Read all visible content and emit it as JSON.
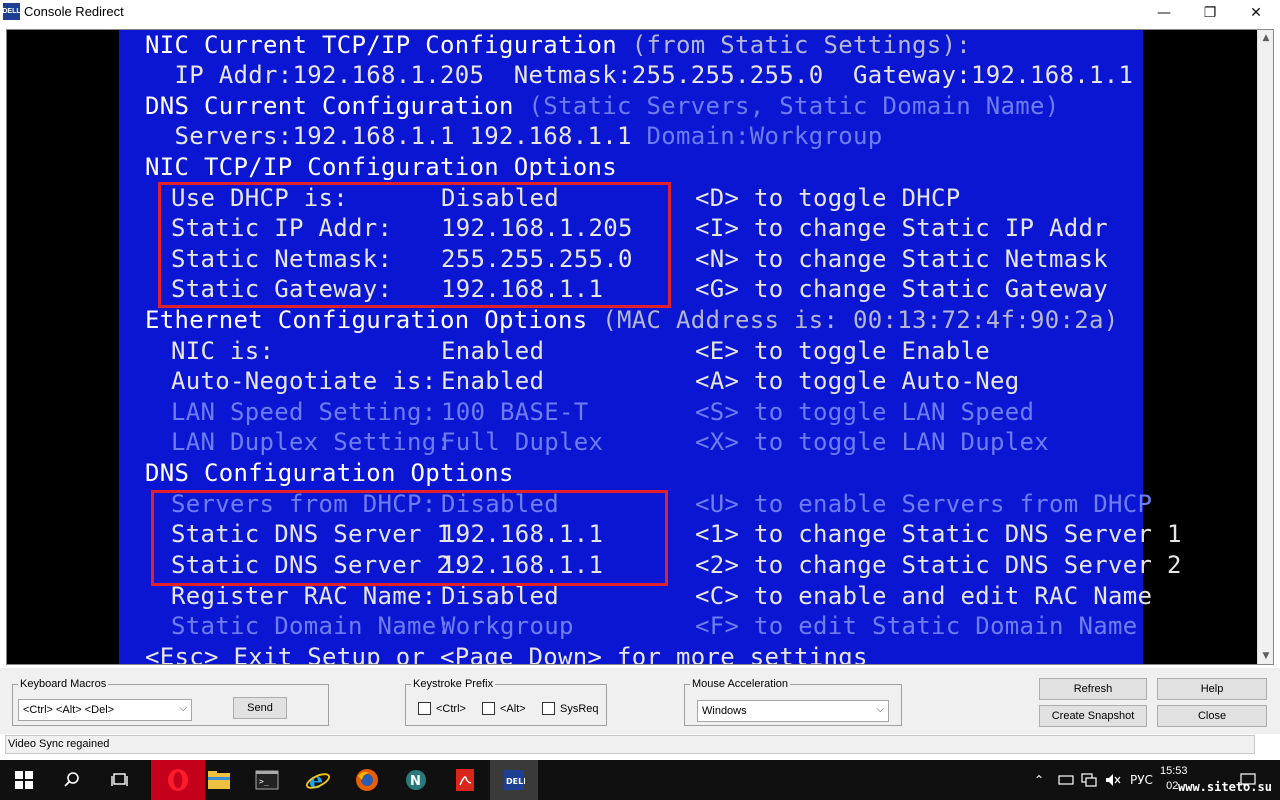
{
  "window": {
    "title": "Console Redirect",
    "icon_text": "DELL",
    "minimize_glyph": "—",
    "maximize_glyph": "❐",
    "close_glyph": "✕"
  },
  "console": {
    "nic_current_title": "NIC Current TCP/IP Configuration",
    "nic_current_suffix": " (from Static Settings):",
    "nic_current_values": "  IP Addr:192.168.1.205  Netmask:255.255.255.0  Gateway:192.168.1.1",
    "dns_current_title": "DNS Current Configuration",
    "dns_current_suffix": " (Static Servers, Static Domain Name)",
    "dns_servers_line": "  Servers:192.168.1.1 192.168.1.1",
    "dns_domain_text": "Domain:Workgroup",
    "nic_options_title": "NIC TCP/IP Configuration Options",
    "nic_options": [
      {
        "label": "Use DHCP is:",
        "value": "Disabled",
        "hint": "<D> to toggle DHCP"
      },
      {
        "label": "Static IP Addr:",
        "value": "192.168.1.205",
        "hint": "<I> to change Static IP Addr"
      },
      {
        "label": "Static Netmask:",
        "value": "255.255.255.0",
        "hint": "<N> to change Static Netmask"
      },
      {
        "label": "Static Gateway:",
        "value": "192.168.1.1",
        "hint": "<G> to change Static Gateway"
      }
    ],
    "ethernet_title": "Ethernet Configuration Options",
    "ethernet_suffix": " (MAC Address is: 00:13:72:4f:90:2a)",
    "ethernet_options": [
      {
        "label": "NIC is:",
        "value": "Enabled",
        "hint": "<E> to toggle Enable"
      },
      {
        "label": "Auto-Negotiate is:",
        "value": "Enabled",
        "hint": "<A> to toggle Auto-Neg"
      },
      {
        "label": "LAN Speed Setting:",
        "value": "100 BASE-T",
        "hint": "<S> to toggle LAN Speed"
      },
      {
        "label": "LAN Duplex Setting:",
        "value": "Full Duplex",
        "hint": "<X> to toggle LAN Duplex"
      }
    ],
    "dns_options_title": "DNS Configuration Options",
    "dns_options": [
      {
        "label": "Servers from DHCP:",
        "value": "Disabled",
        "hint": "<U> to enable Servers from DHCP"
      },
      {
        "label": "Static DNS Server 1:",
        "value": "192.168.1.1",
        "hint": "<1> to change Static DNS Server 1"
      },
      {
        "label": "Static DNS Server 2:",
        "value": "192.168.1.1",
        "hint": "<2> to change Static DNS Server 2"
      },
      {
        "label": "Register RAC Name:",
        "value": "Disabled",
        "hint": "<C> to enable and edit RAC Name"
      },
      {
        "label": "Static Domain Name:",
        "value": "Workgroup",
        "hint": "<F> to edit Static Domain Name"
      }
    ],
    "footer": "<Esc> Exit Setup or <Page Down> for more settings",
    "colors": {
      "background": "#0a16d2",
      "highlight": "#ffffff",
      "dimmed": "#6f7df5",
      "marker": "#e0202a"
    }
  },
  "toolbar": {
    "keyboard_macros_legend": "Keyboard Macros",
    "macro_selected": "<Ctrl> <Alt> <Del>",
    "send_label": "Send",
    "keystroke_prefix_legend": "Keystroke Prefix",
    "prefix_ctrl": "<Ctrl>",
    "prefix_alt": "<Alt>",
    "prefix_sysreq": "SysReq",
    "mouse_accel_legend": "Mouse Acceleration",
    "mouse_accel_selected": "Windows",
    "refresh_label": "Refresh",
    "help_label": "Help",
    "snapshot_label": "Create Snapshot",
    "close_label": "Close"
  },
  "status": {
    "text": "Video Sync regained"
  },
  "taskbar": {
    "language": "РУС",
    "time": "15:53",
    "date": "02.",
    "watermark": "www.siteto.su"
  }
}
